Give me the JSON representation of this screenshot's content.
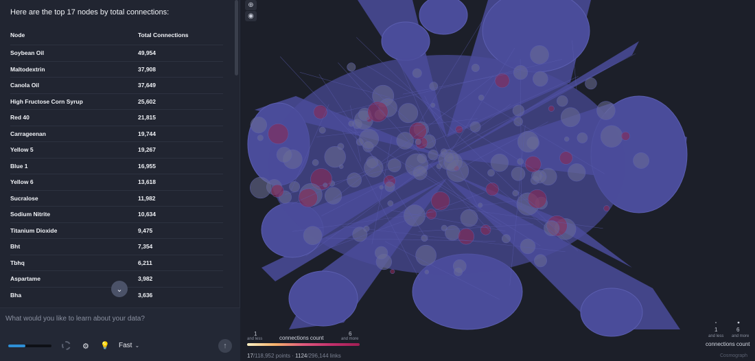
{
  "chat": {
    "intro": "Here are the top 17 nodes by total connections:",
    "table": {
      "headers": [
        "Node",
        "Total Connections"
      ],
      "rows": [
        {
          "node": "Soybean Oil",
          "total": "49,954"
        },
        {
          "node": "Maltodextrin",
          "total": "37,908"
        },
        {
          "node": "Canola Oil",
          "total": "37,649"
        },
        {
          "node": "High Fructose Corn Syrup",
          "total": "25,602"
        },
        {
          "node": "Red 40",
          "total": "21,815"
        },
        {
          "node": "Carrageenan",
          "total": "19,744"
        },
        {
          "node": "Yellow 5",
          "total": "19,267"
        },
        {
          "node": "Blue 1",
          "total": "16,955"
        },
        {
          "node": "Yellow 6",
          "total": "13,618"
        },
        {
          "node": "Sucralose",
          "total": "11,982"
        },
        {
          "node": "Sodium Nitrite",
          "total": "10,634"
        },
        {
          "node": "Titanium Dioxide",
          "total": "9,475"
        },
        {
          "node": "Bht",
          "total": "7,354"
        },
        {
          "node": "Tbhq",
          "total": "6,211"
        },
        {
          "node": "Aspartame",
          "total": "3,982"
        },
        {
          "node": "Bha",
          "total": "3,636"
        }
      ]
    },
    "scroll_down_icon": "chevron-down-icon",
    "composer": {
      "placeholder": "What would you like to learn about your data?",
      "usage_fraction": 0.4,
      "mode_label": "Fast",
      "settings_icon": "gear-icon",
      "bulb_icon": "lightbulb-icon",
      "send_icon": "arrow-up-icon"
    }
  },
  "graph": {
    "toolbar_icons": [
      "zoom-in-icon",
      "camera-icon"
    ],
    "color_legend": {
      "min_value": "1",
      "min_caption": "and less",
      "title": "connections count",
      "max_value": "6",
      "max_caption": "and more",
      "gradient_colors": [
        "#fdf0c4",
        "#f6b26b",
        "#e05a7e",
        "#c2306c",
        "#a11e53"
      ]
    },
    "size_legend": {
      "min_value": "1",
      "min_caption": "and less",
      "max_value": "6",
      "max_caption": "and more",
      "title": "connections count"
    },
    "stats": {
      "points_shown": "17",
      "points_total": "/118,952 points",
      "separator": "·",
      "links_shown": "1124",
      "links_total": "/296,144 links"
    },
    "brand": "Cosmograph",
    "colors": {
      "background": "#1c1f29",
      "node_fill": "#4a4c9a",
      "node_edge": "#5b5eb0",
      "highlight": "#8a2a55"
    }
  }
}
